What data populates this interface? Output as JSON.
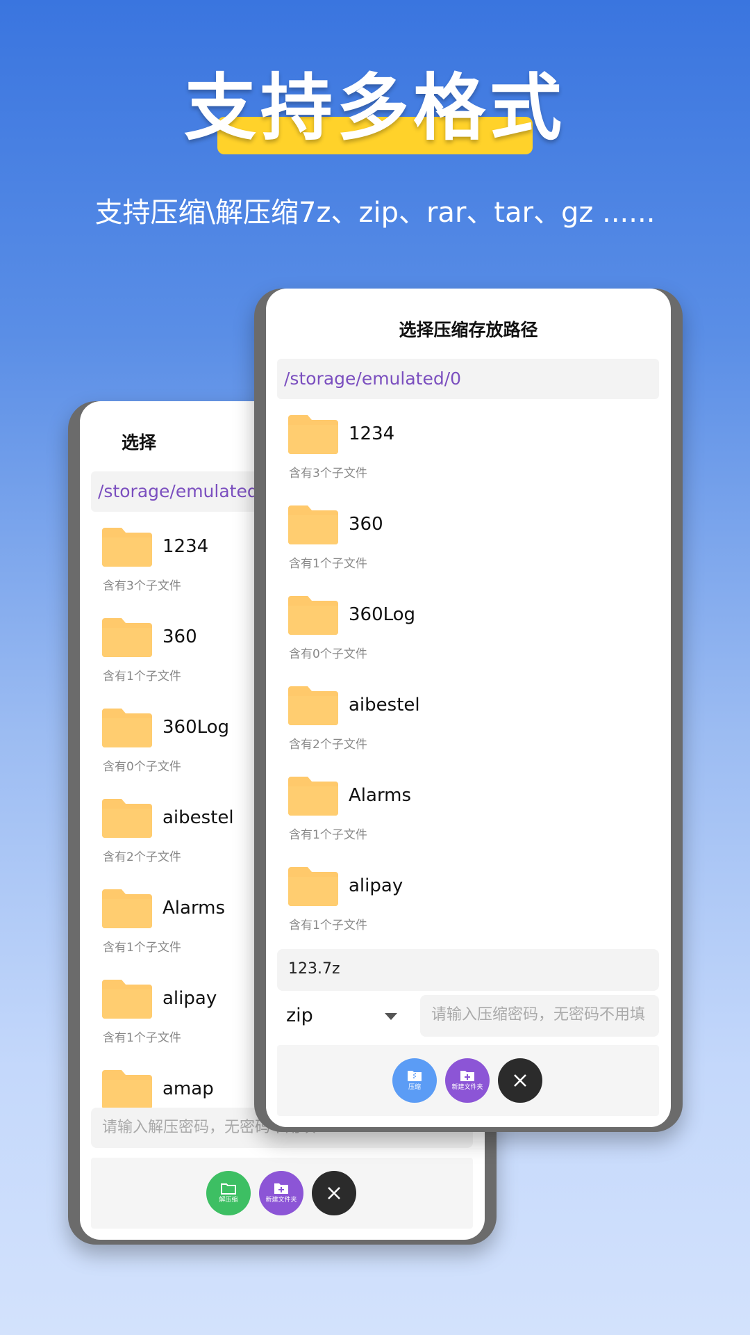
{
  "header": {
    "headline": "支持多格式",
    "subline": "支持压缩\\解压缩7z、zip、rar、tar、gz ......"
  },
  "colors": {
    "highlight": "#ffd22a",
    "folder": "#ffc96b",
    "path_text": "#7b4fbf",
    "fab_compress": "#5b9cf5",
    "fab_extract": "#3dbf63",
    "fab_newfolder": "#8c55d6",
    "fab_close": "#2b2b2b"
  },
  "back_dialog": {
    "title": "选择",
    "path": "/storage/emulated/0",
    "folders": [
      {
        "name": "1234",
        "sub": "含有3个子文件"
      },
      {
        "name": "360",
        "sub": "含有1个子文件"
      },
      {
        "name": "360Log",
        "sub": "含有0个子文件"
      },
      {
        "name": "aibestel",
        "sub": "含有2个子文件"
      },
      {
        "name": "Alarms",
        "sub": "含有1个子文件"
      },
      {
        "name": "alipay",
        "sub": "含有1个子文件"
      },
      {
        "name": "amap",
        "sub": ""
      }
    ],
    "password_placeholder": "请输入解压密码，无密码不用填",
    "buttons": {
      "extract": {
        "label": "解压缩",
        "icon": "folder-icon"
      },
      "new_folder": {
        "label": "新建文件夹",
        "icon": "folder-plus-icon"
      },
      "close": {
        "icon": "close-icon"
      }
    }
  },
  "front_dialog": {
    "title": "选择压缩存放路径",
    "path": "/storage/emulated/0",
    "folders": [
      {
        "name": "1234",
        "sub": "含有3个子文件"
      },
      {
        "name": "360",
        "sub": "含有1个子文件"
      },
      {
        "name": "360Log",
        "sub": "含有0个子文件"
      },
      {
        "name": "aibestel",
        "sub": "含有2个子文件"
      },
      {
        "name": "Alarms",
        "sub": "含有1个子文件"
      },
      {
        "name": "alipay",
        "sub": "含有1个子文件"
      }
    ],
    "filename": "123.7z",
    "format_selected": "zip",
    "password_placeholder": "请输入压缩密码，无密码不用填",
    "buttons": {
      "compress": {
        "label": "压缩",
        "icon": "zip-file-icon"
      },
      "new_folder": {
        "label": "新建文件夹",
        "icon": "folder-plus-icon"
      },
      "close": {
        "icon": "close-icon"
      }
    }
  }
}
